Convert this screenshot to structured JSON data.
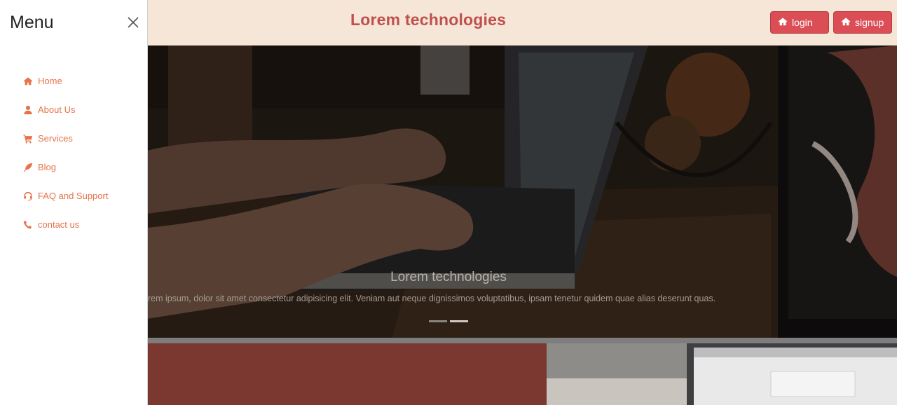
{
  "navbar": {
    "brand": "Lorem technologies",
    "login_label": "login",
    "signup_label": "signup",
    "login_icon": "home-icon",
    "signup_icon": "home-icon"
  },
  "hero": {
    "title": "Lorem technologies",
    "text": "orem ipsum, dolor sit amet consectetur adipisicing elit. Veniam aut neque dignissimos voluptatibus, ipsam tenetur quidem quae alias deserunt quas.",
    "slides_total": 2,
    "active_slide": 2
  },
  "offcanvas": {
    "title": "Menu",
    "close_icon": "close-icon",
    "items": [
      {
        "label": "Home",
        "icon": "home-icon"
      },
      {
        "label": "About Us",
        "icon": "user-icon"
      },
      {
        "label": "Services",
        "icon": "cart-icon"
      },
      {
        "label": "Blog",
        "icon": "feather-icon"
      },
      {
        "label": "FAQ and Support",
        "icon": "headset-icon"
      },
      {
        "label": "contact us",
        "icon": "phone-icon"
      }
    ]
  },
  "colors": {
    "navbar_bg": "#f5e6d8",
    "brand": "#c0504d",
    "button_bg": "#dc4e56",
    "menu_accent": "#e8734a",
    "section_red": "#7b3830"
  }
}
